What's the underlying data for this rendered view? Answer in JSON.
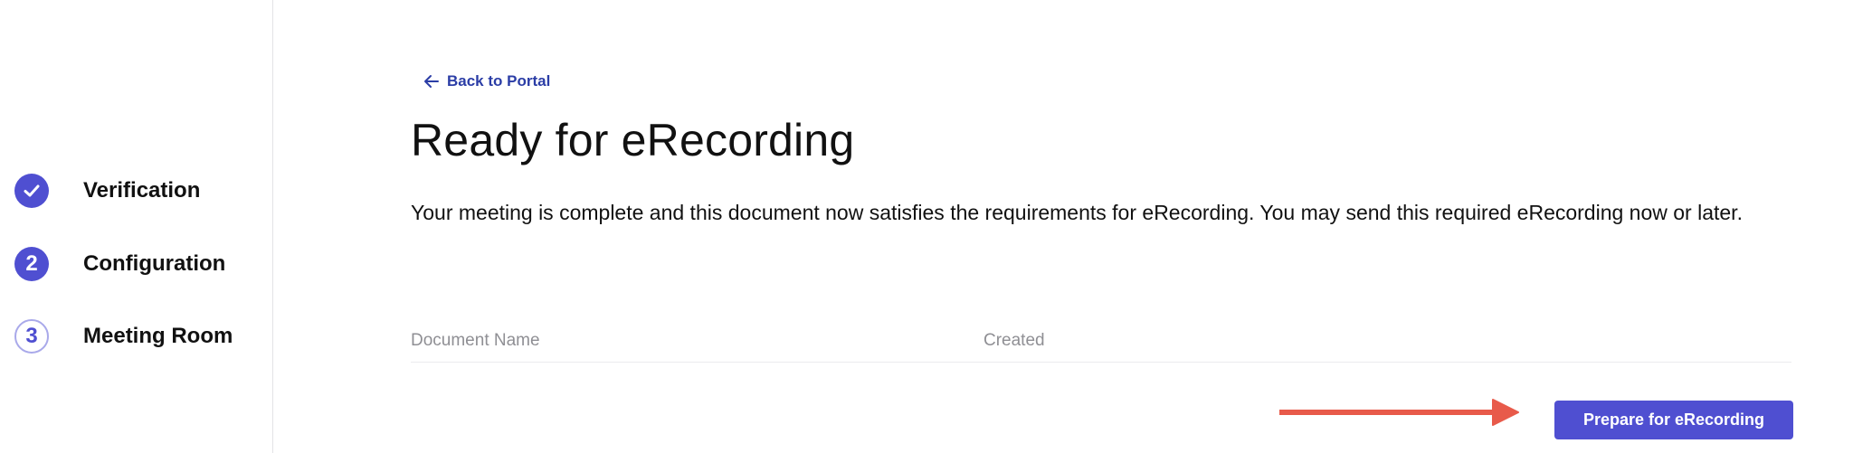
{
  "sidebar": {
    "steps": [
      {
        "number": "",
        "label": "Verification",
        "state": "done"
      },
      {
        "number": "2",
        "label": "Configuration",
        "state": "active"
      },
      {
        "number": "3",
        "label": "Meeting Room",
        "state": "pending"
      }
    ]
  },
  "main": {
    "back_link": "Back to Portal",
    "title": "Ready for eRecording",
    "description": "Your meeting is complete and this document now satisfies the requirements for eRecording. You may send this required eRecording now or later.",
    "table": {
      "columns": [
        "Document Name",
        "Created"
      ]
    },
    "primary_button": "Prepare for eRecording"
  },
  "colors": {
    "accent": "#4f4fd1",
    "link": "#2b3da6",
    "annotation_arrow": "#e85a4a"
  }
}
